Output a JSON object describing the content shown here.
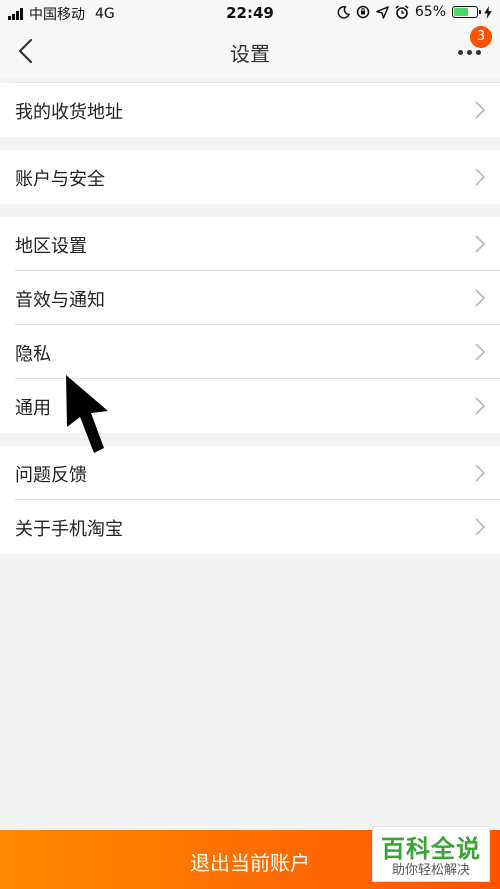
{
  "status_bar": {
    "carrier": "中国移动",
    "network": "4G",
    "time": "22:49",
    "battery": "65%",
    "battery_level": 0.65,
    "icons": [
      "moon-icon",
      "orientation-lock-icon",
      "location-icon",
      "alarm-icon",
      "battery-icon",
      "charging-icon"
    ]
  },
  "navbar": {
    "title": "设置",
    "back_icon": "chevron-left-icon",
    "more_icon": "more-dots-icon",
    "badge_count": "3"
  },
  "groups": [
    {
      "items": [
        {
          "label": "我的收货地址"
        }
      ]
    },
    {
      "items": [
        {
          "label": "账户与安全"
        }
      ]
    },
    {
      "items": [
        {
          "label": "地区设置"
        },
        {
          "label": "音效与通知"
        },
        {
          "label": "隐私"
        },
        {
          "label": "通用"
        }
      ]
    },
    {
      "items": [
        {
          "label": "问题反馈"
        },
        {
          "label": "关于手机淘宝"
        }
      ]
    }
  ],
  "logout_button": {
    "label": "退出当前账户"
  },
  "watermark": {
    "title": "百科全说",
    "subtitle": "助你轻松解决"
  },
  "colors": {
    "accent": "#ff5000",
    "logout_start": "#ff8a00",
    "logout_end": "#ff5200",
    "battery_fill": "#4cd964",
    "watermark_green": "#3aa335"
  }
}
